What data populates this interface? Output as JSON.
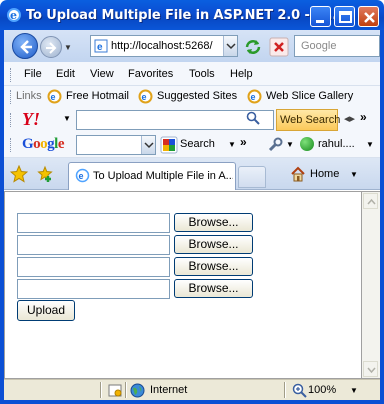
{
  "window": {
    "title": "To Upload Multiple File in ASP.NET 2.0 - W..."
  },
  "address": {
    "url": "http://localhost:5268/",
    "search_placeholder": "Google"
  },
  "menu": [
    "File",
    "Edit",
    "View",
    "Favorites",
    "Tools",
    "Help"
  ],
  "links": {
    "label": "Links",
    "items": [
      "Free Hotmail",
      "Suggested Sites",
      "Web Slice Gallery"
    ]
  },
  "yahoo": {
    "logo": "Y!",
    "button": "Web Search"
  },
  "google": {
    "logo": "Google",
    "search_label": "Search",
    "user": "rahul...."
  },
  "tabs": {
    "active_label": "To Upload Multiple File in A...",
    "home_label": "Home"
  },
  "form": {
    "browse_labels": [
      "Browse...",
      "Browse...",
      "Browse...",
      "Browse..."
    ],
    "upload_label": "Upload"
  },
  "status": {
    "zone": "Internet",
    "zoom": "100%"
  },
  "colors": {
    "titlebar": "#0b4fd4",
    "yahoo_red": "#d80018",
    "web_search_bg": "#fbc95a"
  }
}
